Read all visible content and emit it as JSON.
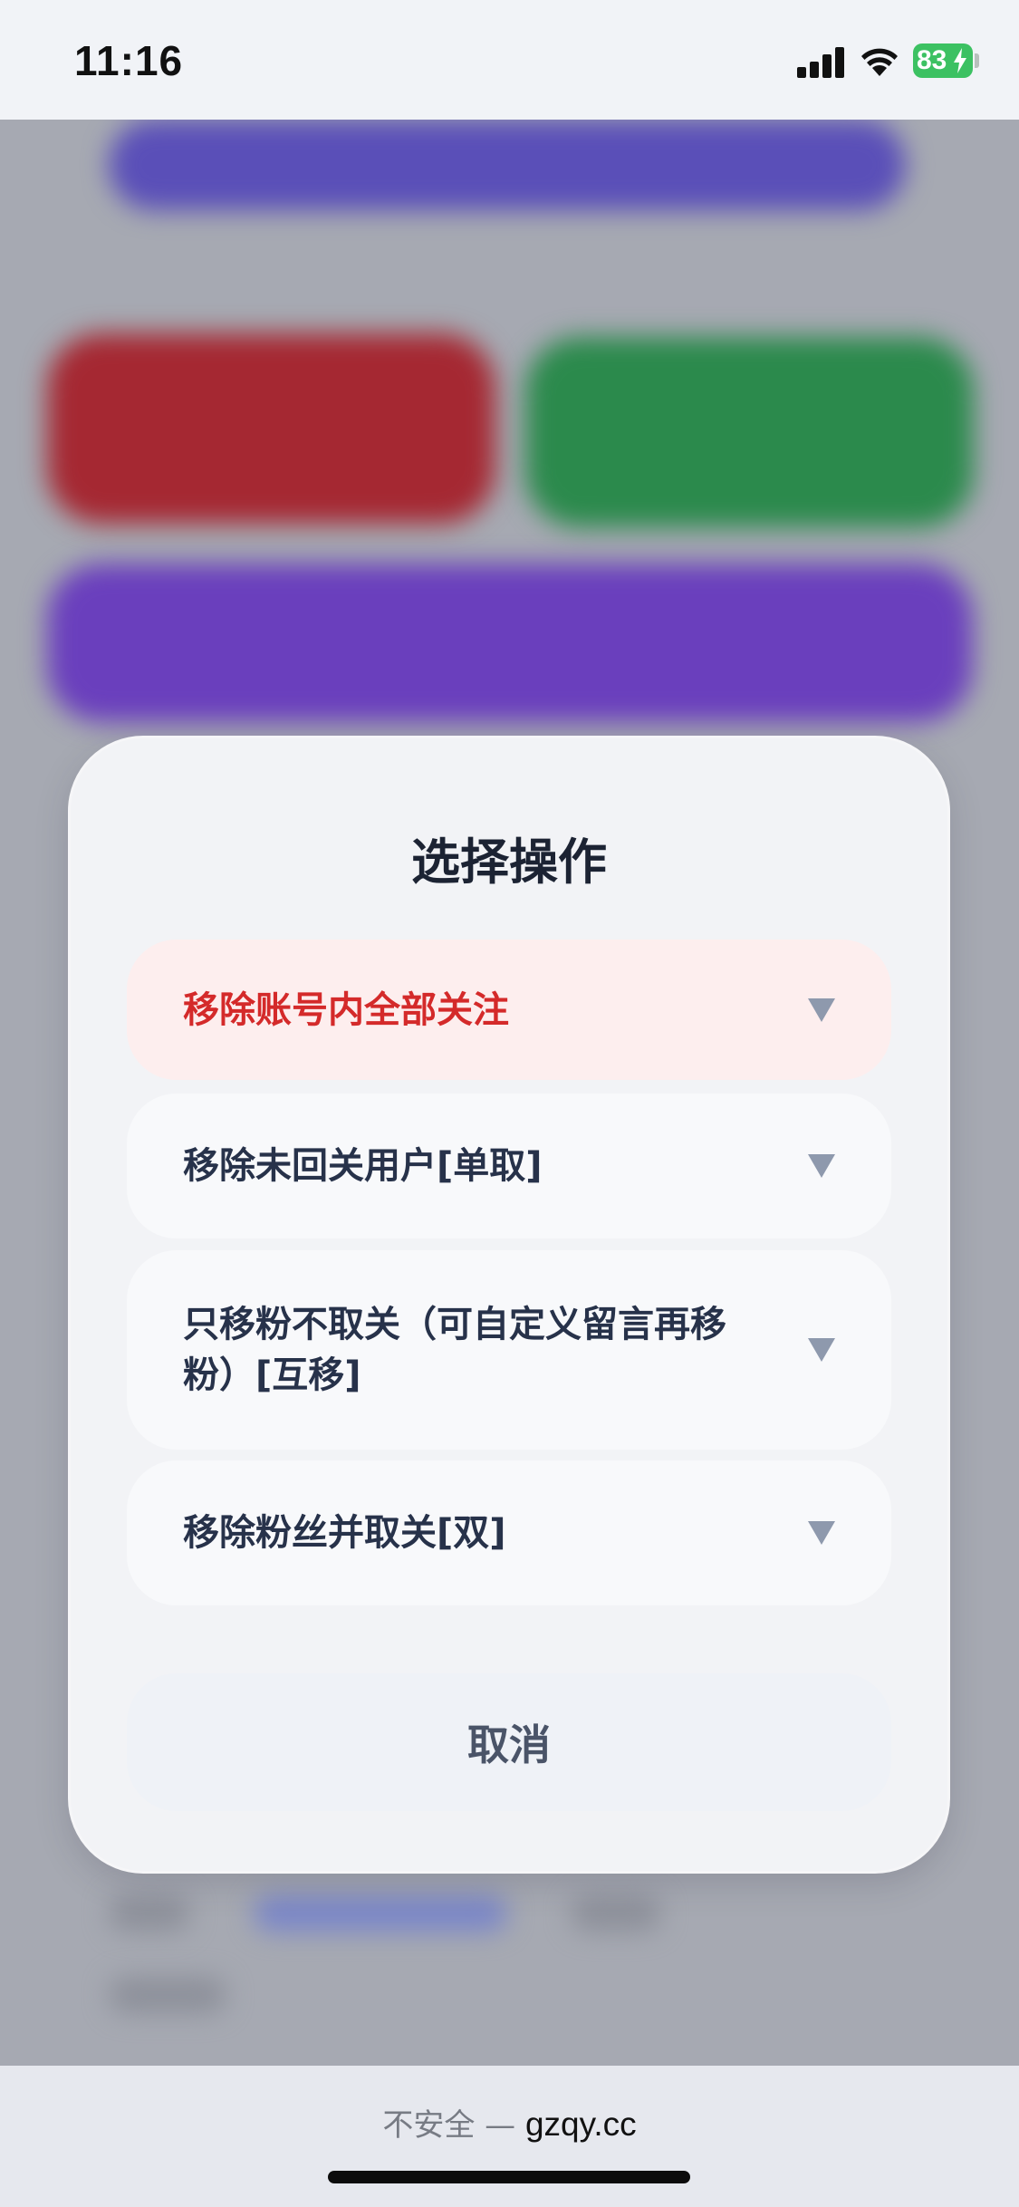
{
  "status_bar": {
    "time": "11:16",
    "battery_level": "83",
    "icons": [
      "cellular-signal-icon",
      "wifi-icon",
      "battery-charging-icon"
    ]
  },
  "dialog": {
    "title": "选择操作",
    "options": [
      {
        "label": "移除账号内全部关注",
        "icon": "triangle-down-icon",
        "highlighted": true,
        "color": "#d42a2a"
      },
      {
        "label": "移除未回关用户[单取]",
        "icon": "triangle-down-icon"
      },
      {
        "label": "只移粉不取关（可自定义留言再移粉）[互移]",
        "icon": "triangle-down-icon"
      },
      {
        "label": "移除粉丝并取关[双]",
        "icon": "triangle-down-icon"
      }
    ],
    "cancel_label": "取消"
  },
  "browser_bar": {
    "security_label": "不安全 —",
    "domain": "gzqy.cc"
  },
  "colors": {
    "danger": "#d42a2a",
    "text_primary": "#1c2333",
    "battery_green": "#3cc162"
  }
}
